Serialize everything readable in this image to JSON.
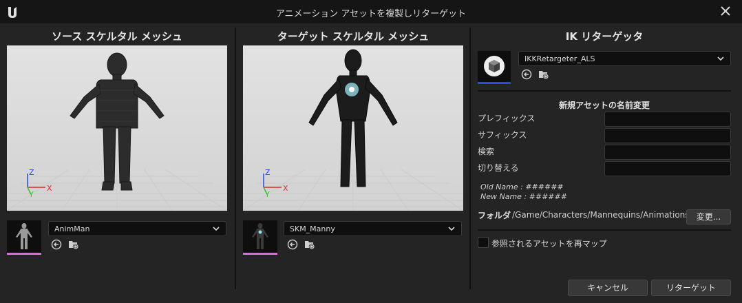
{
  "window": {
    "title": "アニメーション アセットを複製しリターゲット",
    "logo_icon": "unreal-engine-logo",
    "close_icon": "close-icon"
  },
  "source": {
    "heading": "ソース スケルタル メッシュ",
    "mesh_name": "AnimMan",
    "thumb_icon": "mannequin-thumbnail"
  },
  "target": {
    "heading": "ターゲット スケルタル メッシュ",
    "mesh_name": "SKM_Manny",
    "thumb_icon": "manny-thumbnail"
  },
  "axes": {
    "z": "Z",
    "y": "Y",
    "x": "X"
  },
  "retargeter": {
    "heading": "IK リターゲッタ",
    "asset_name": "IKKRetargeter_ALS",
    "asset_icon": "cube-asset-icon"
  },
  "rename": {
    "heading": "新規アセットの名前変更",
    "prefix_label": "プレフィックス",
    "suffix_label": "サフィックス",
    "search_label": "検索",
    "replace_label": "切り替える",
    "prefix_value": "",
    "suffix_value": "",
    "search_value": "",
    "replace_value": "",
    "old_name": "Old Name : ######",
    "new_name": "New Name : ######"
  },
  "folder": {
    "label": "フォルダ",
    "path": "/Game/Characters/Mannequins/Animations",
    "change_button": "変更..."
  },
  "remap": {
    "label": "参照されるアセットを再マップ",
    "checked": false
  },
  "buttons": {
    "cancel": "キャンセル",
    "retarget": "リターゲット"
  },
  "colors": {
    "source_thumb_accent": "#e06adb",
    "retargeter_accent": "#2b4bd6",
    "axis_x": "#e0282a",
    "axis_y": "#2fc22f",
    "axis_z": "#2a4ae0"
  }
}
